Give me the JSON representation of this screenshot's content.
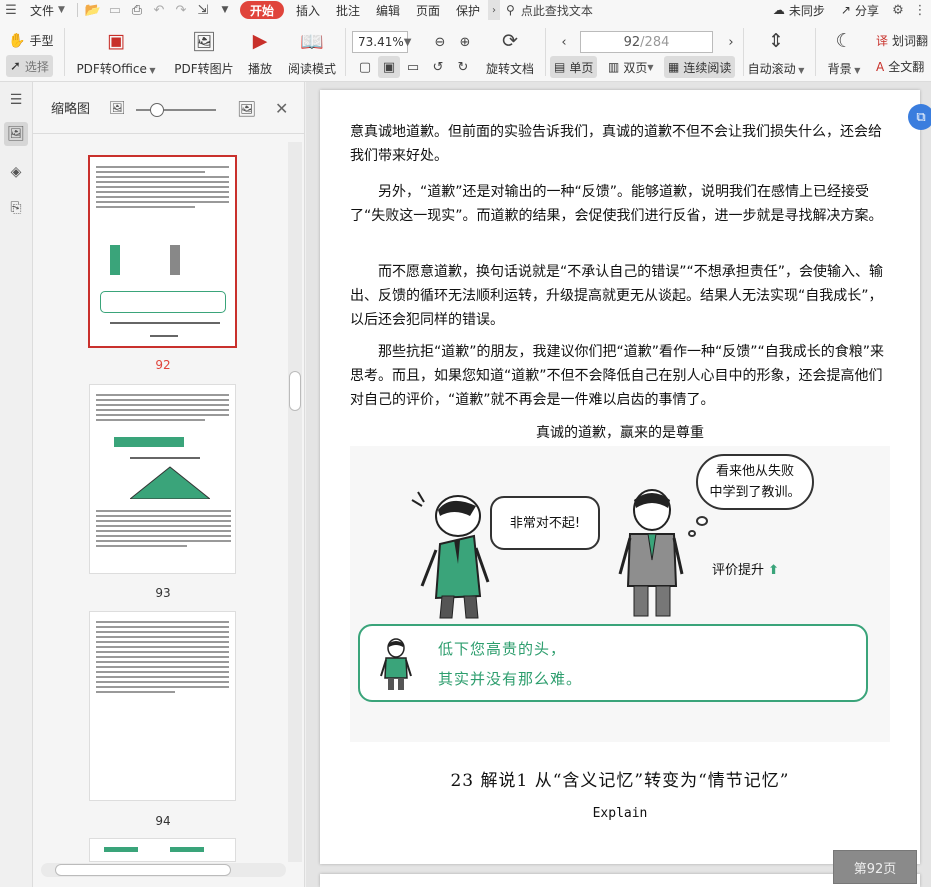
{
  "menubar": {
    "file": "文件",
    "start": "开始",
    "insert": "插入",
    "annotate": "批注",
    "edit": "编辑",
    "page": "页面",
    "protect": "保护",
    "search": "点此查找文本",
    "sync": "未同步",
    "share": "分享"
  },
  "toolbar": {
    "hand": "手型",
    "select": "选择",
    "pdf_to_office": "PDF转Office",
    "pdf_to_image": "PDF转图片",
    "play": "播放",
    "read_mode": "阅读模式",
    "zoom": "73.41%",
    "current_page": "92",
    "total_pages": "/284",
    "rotate": "旋转文档",
    "single": "单页",
    "double": "双页",
    "continuous": "连续阅读",
    "auto_scroll": "自动滚动",
    "background": "背景",
    "underline_words": "划词翻",
    "full_text": "全文翻"
  },
  "thumbnails": {
    "title": "缩略图",
    "pages": [
      {
        "num": "92",
        "selected": true
      },
      {
        "num": "93",
        "selected": false
      },
      {
        "num": "94",
        "selected": false
      }
    ]
  },
  "document": {
    "p1": "意真诚地道歉。但前面的实验告诉我们，真诚的道歉不但不会让我们损失什么，还会给我们带来好处。",
    "p2": "另外，“道歉”还是对输出的一种“反馈”。能够道歉，说明我们在感情上已经接受了“失败这一现实”。而道歉的结果，会促使我们进行反省，进一步就是寻找解决方案。",
    "p3": "而不愿意道歉，换句话说就是“不承认自己的错误”“不想承担责任”，会使输入、输出、反馈的循环无法顺利运转，升级提高就更无从谈起。结果人无法实现“自我成长”，以后还会犯同样的错误。",
    "p4": "那些抗拒“道歉”的朋友，我建议你们把“道歉”看作一种“反馈”“自我成长的食粮”来思考。而且，如果您知道“道歉”不但不会降低自己在别人心目中的形象，还会提高他们对自己的评价，“道歉”就不再会是一件难以启齿的事情了。",
    "caption": "真诚的道歉，赢来的是尊重",
    "bubble_sorry": "非常对不起!",
    "bubble_learn_1": "看来他从失败",
    "bubble_learn_2": "中学到了教训。",
    "rating_up": "评价提升",
    "panel_line1": "低下您高贵的头，",
    "panel_line2": "其实并没有那么难。",
    "heading": "23 解说1  从“含义记忆”转变为“情节记忆”",
    "explain": "Explain",
    "page_badge": "第92页"
  },
  "colors": {
    "accent_red": "#e0443b",
    "green": "#3aa47a",
    "suit_green": "#3aa47a",
    "suit_gray": "#8e8e8e"
  }
}
